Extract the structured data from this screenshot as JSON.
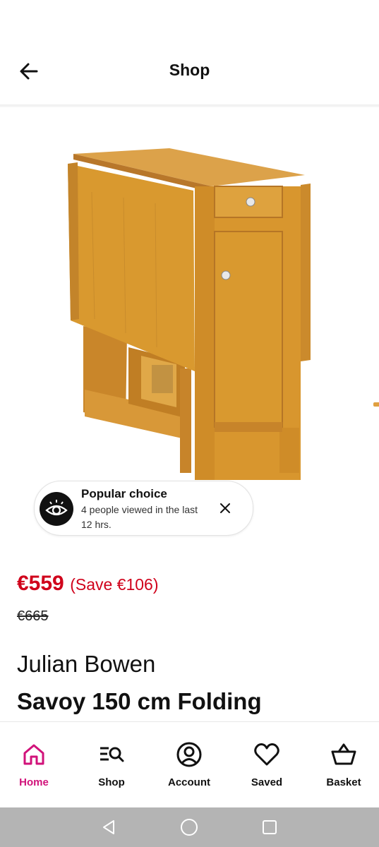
{
  "header": {
    "title": "Shop"
  },
  "product": {
    "image_alt": "Savoy 150 cm Folding",
    "price_now": "€559",
    "price_save": "(Save €106)",
    "price_was": "€665",
    "brand": "Julian Bowen",
    "name": "Savoy 150 cm Folding"
  },
  "popular": {
    "title": "Popular choice",
    "text": "4 people viewed in the last 12 hrs."
  },
  "nav": {
    "active_color": "#d1127a",
    "items": [
      {
        "label": "Home",
        "icon": "home-icon"
      },
      {
        "label": "Shop",
        "icon": "shop-search-icon"
      },
      {
        "label": "Account",
        "icon": "account-icon"
      },
      {
        "label": "Saved",
        "icon": "heart-icon"
      },
      {
        "label": "Basket",
        "icon": "basket-icon"
      }
    ]
  },
  "colors": {
    "price": "#d0021b",
    "brand_pink": "#d1127a",
    "system_bar": "#b4b4b4"
  }
}
